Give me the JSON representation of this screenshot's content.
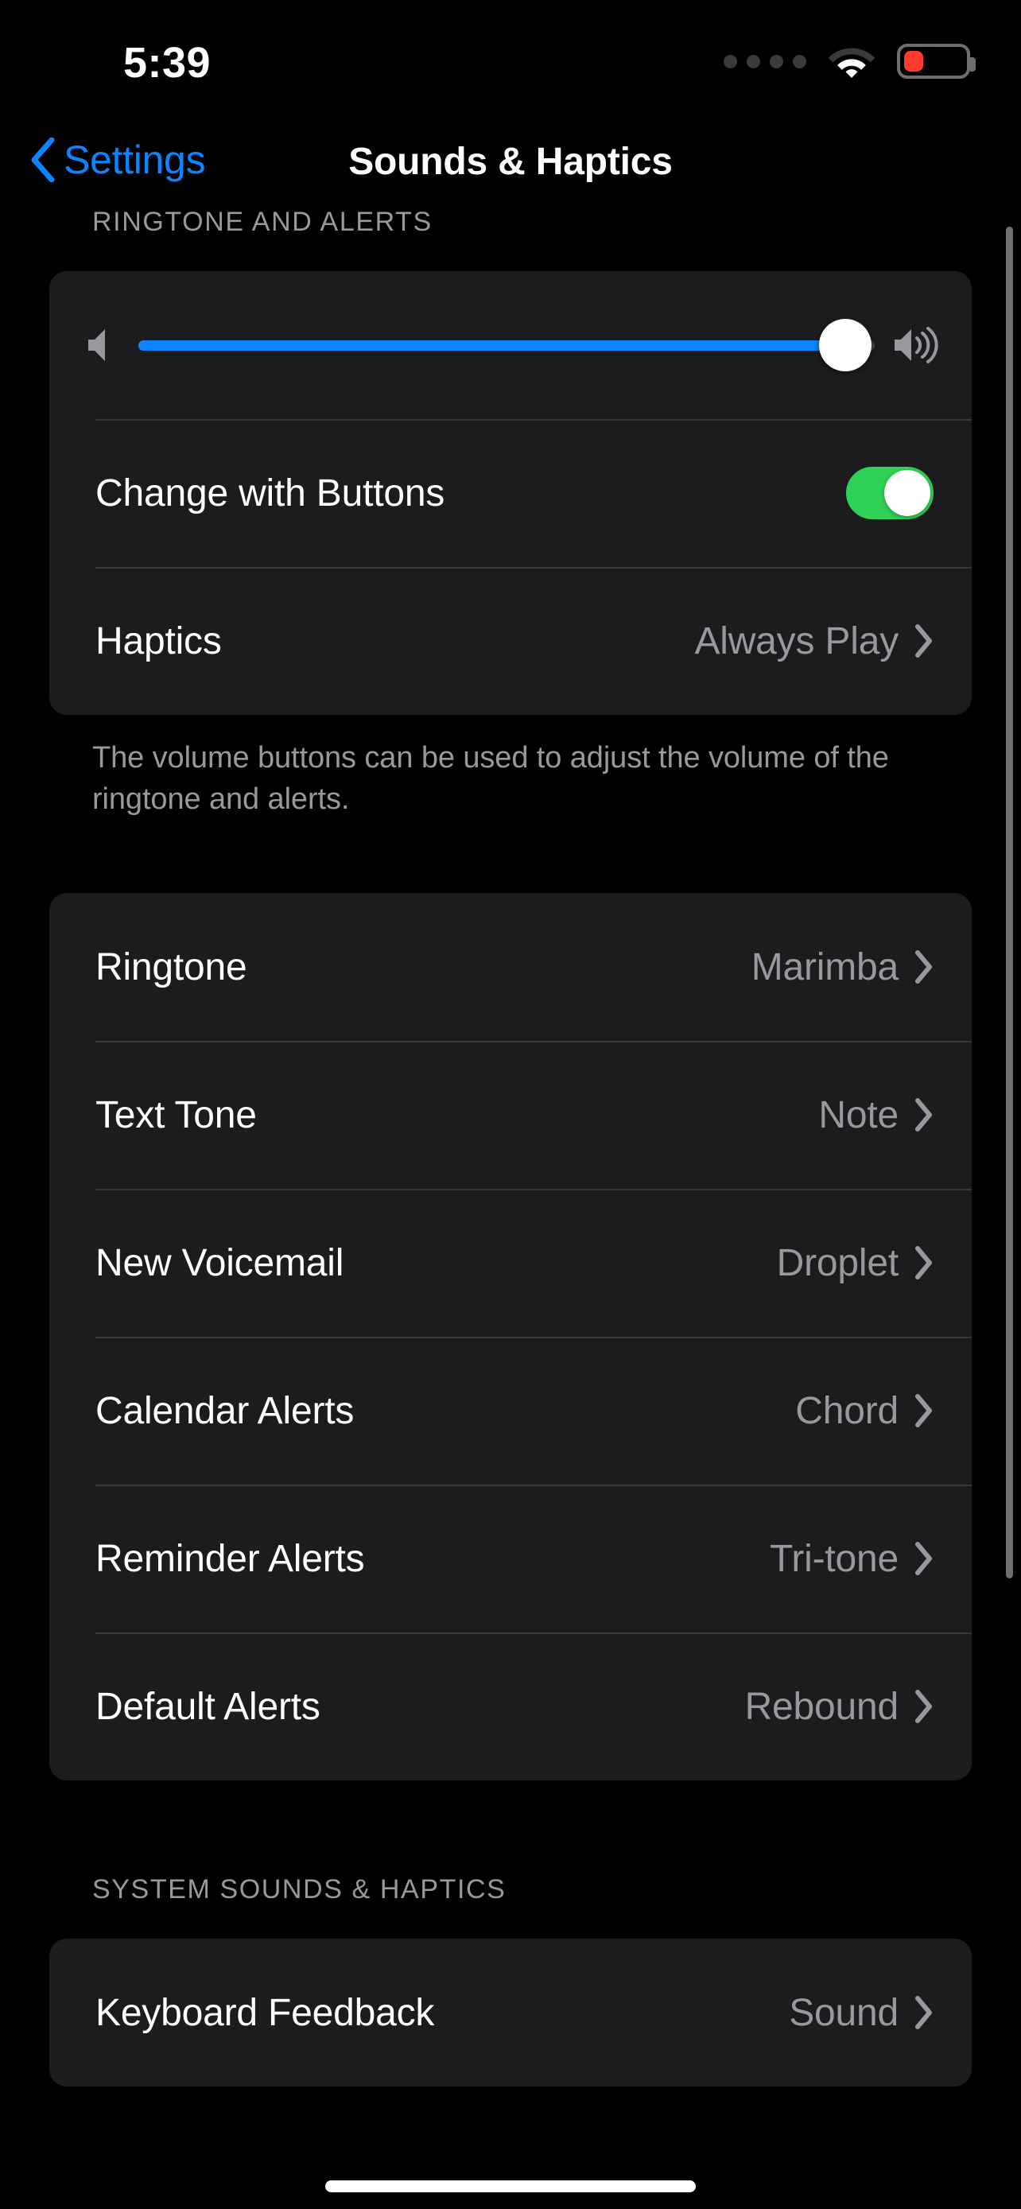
{
  "status_bar": {
    "time": "5:39",
    "cellular_icon": "cellular-dots-icon",
    "wifi_icon": "wifi-icon",
    "battery_icon": "battery-low-icon",
    "battery_color": "#ff3b30",
    "battery_level_percent": 15
  },
  "nav": {
    "back_icon": "chevron-left-icon",
    "back_label": "Settings",
    "title": "Sounds & Haptics",
    "accent_color": "#0a84ff"
  },
  "sections": [
    {
      "header": "RINGTONE AND ALERTS",
      "footer": "The volume buttons can be used to adjust the volume of the ringtone and alerts."
    },
    {
      "header": "",
      "footer": ""
    },
    {
      "header": "SYSTEM SOUNDS & HAPTICS",
      "footer": ""
    }
  ],
  "volume_slider": {
    "min_icon": "speaker-low-icon",
    "max_icon": "speaker-high-icon",
    "value_percent": 96,
    "fill_color": "#0a84ff",
    "track_color": "#48484a"
  },
  "change_with_buttons": {
    "label": "Change with Buttons",
    "toggle_state": "on",
    "toggle_on_color": "#30d158"
  },
  "haptics": {
    "label": "Haptics",
    "value": "Always Play",
    "chevron_icon": "chevron-right-icon"
  },
  "tone_rows": [
    {
      "label": "Ringtone",
      "value": "Marimba",
      "chevron_icon": "chevron-right-icon"
    },
    {
      "label": "Text Tone",
      "value": "Note",
      "chevron_icon": "chevron-right-icon"
    },
    {
      "label": "New Voicemail",
      "value": "Droplet",
      "chevron_icon": "chevron-right-icon"
    },
    {
      "label": "Calendar Alerts",
      "value": "Chord",
      "chevron_icon": "chevron-right-icon"
    },
    {
      "label": "Reminder Alerts",
      "value": "Tri-tone",
      "chevron_icon": "chevron-right-icon"
    },
    {
      "label": "Default Alerts",
      "value": "Rebound",
      "chevron_icon": "chevron-right-icon"
    }
  ],
  "system_rows": [
    {
      "label": "Keyboard Feedback",
      "value": "Sound",
      "chevron_icon": "chevron-right-icon"
    }
  ],
  "home_indicator": "home-indicator"
}
